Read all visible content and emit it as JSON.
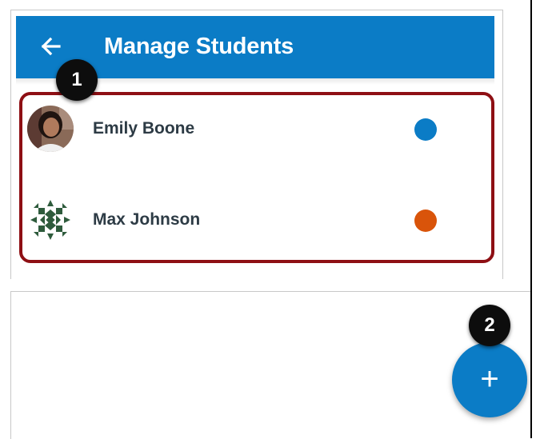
{
  "header": {
    "title": "Manage Students",
    "back_icon": "arrow-left-icon",
    "color": "#0b7cc6"
  },
  "students": [
    {
      "name": "Emily Boone",
      "color": "#0b7cc6",
      "avatar": "photo-avatar"
    },
    {
      "name": "Max Johnson",
      "color": "#d9540a",
      "avatar": "pattern-avatar"
    }
  ],
  "callouts": [
    "1",
    "2"
  ],
  "fab": {
    "icon": "plus-icon",
    "symbol": "+"
  },
  "highlight_color": "#8e0f14"
}
